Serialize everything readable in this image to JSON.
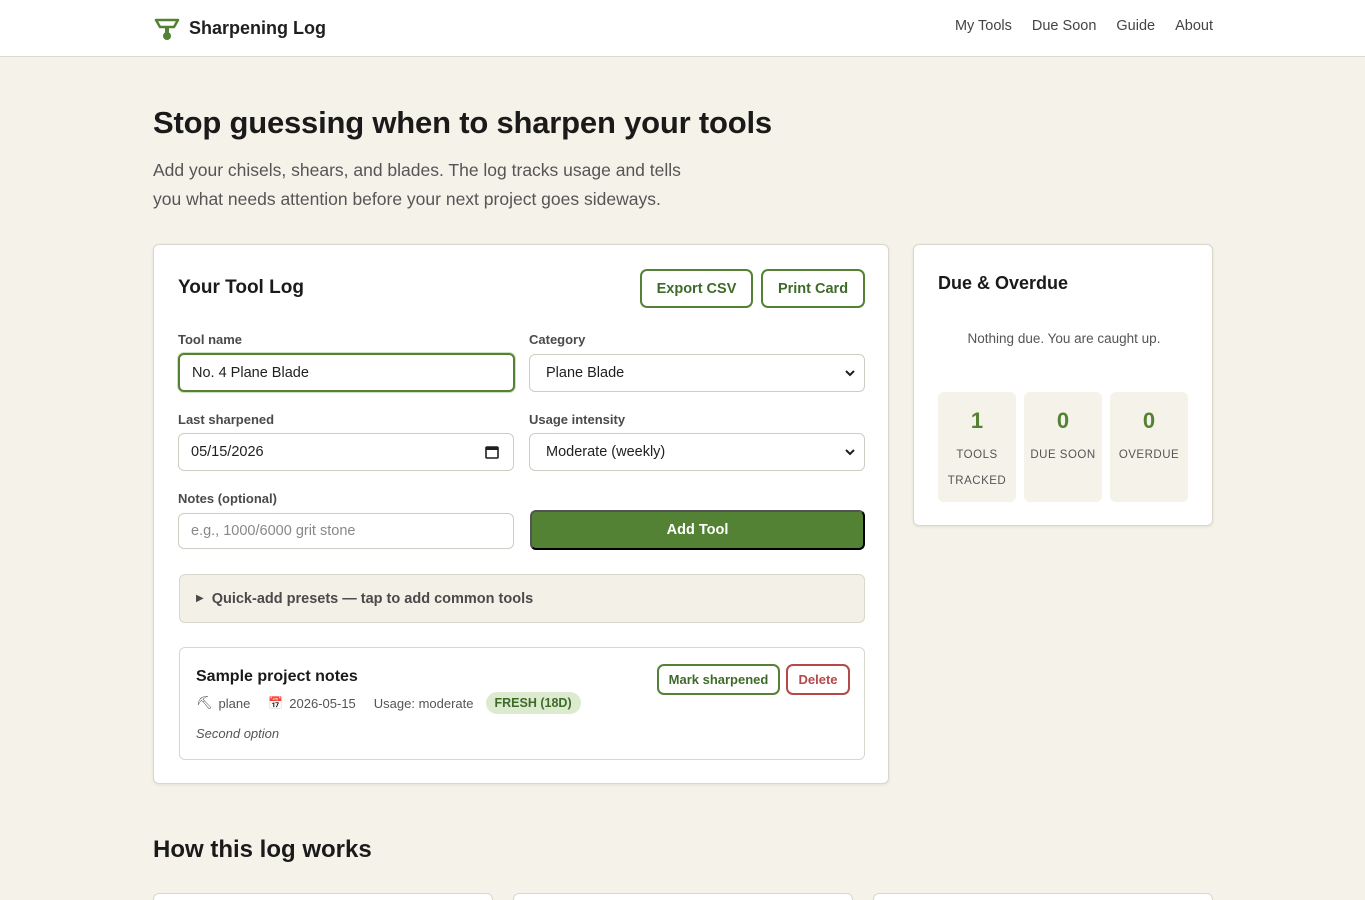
{
  "brand": {
    "name": "Sharpening Log",
    "icon": "sharpening-stone-icon",
    "accent": "#548235"
  },
  "nav": {
    "items": [
      "My Tools",
      "Due Soon",
      "Guide",
      "About"
    ]
  },
  "hero": {
    "title": "Stop guessing when to sharpen your tools",
    "subtitle_line1": "Add your chisels, shears, and blades. The log tracks usage and tells",
    "subtitle_line2": "you what needs attention before your next project goes sideways."
  },
  "log": {
    "title": "Your Tool Log",
    "export_label": "Export CSV",
    "print_label": "Print Card",
    "fields": {
      "tool_name_label": "Tool name",
      "tool_name_value": "No. 4 Plane Blade",
      "category_label": "Category",
      "category_value": "Plane Blade",
      "last_sharpened_label": "Last sharpened",
      "last_sharpened_value": "05/15/2026",
      "usage_label": "Usage intensity",
      "usage_value": "Moderate (weekly)",
      "notes_label": "Notes (optional)",
      "notes_placeholder": "e.g., 1000/6000 grit stone"
    },
    "add_label": "Add Tool",
    "presets_label": "Quick-add presets — tap to add common tools",
    "item": {
      "name": "Sample project notes",
      "category_icon": "⛏",
      "category": "plane",
      "date_icon": "📅",
      "date": "2026-05-15",
      "usage": "Usage: moderate",
      "badge": "FRESH (18D)",
      "note": "Second option",
      "mark_label": "Mark sharpened",
      "delete_label": "Delete"
    }
  },
  "due": {
    "title": "Due & Overdue",
    "empty_message": "Nothing due. You are caught up.",
    "stats": [
      {
        "value": "1",
        "label": "TOOLS TRACKED"
      },
      {
        "value": "0",
        "label": "DUE SOON"
      },
      {
        "value": "0",
        "label": "OVERDUE"
      }
    ]
  },
  "how": {
    "title": "How this log works"
  }
}
